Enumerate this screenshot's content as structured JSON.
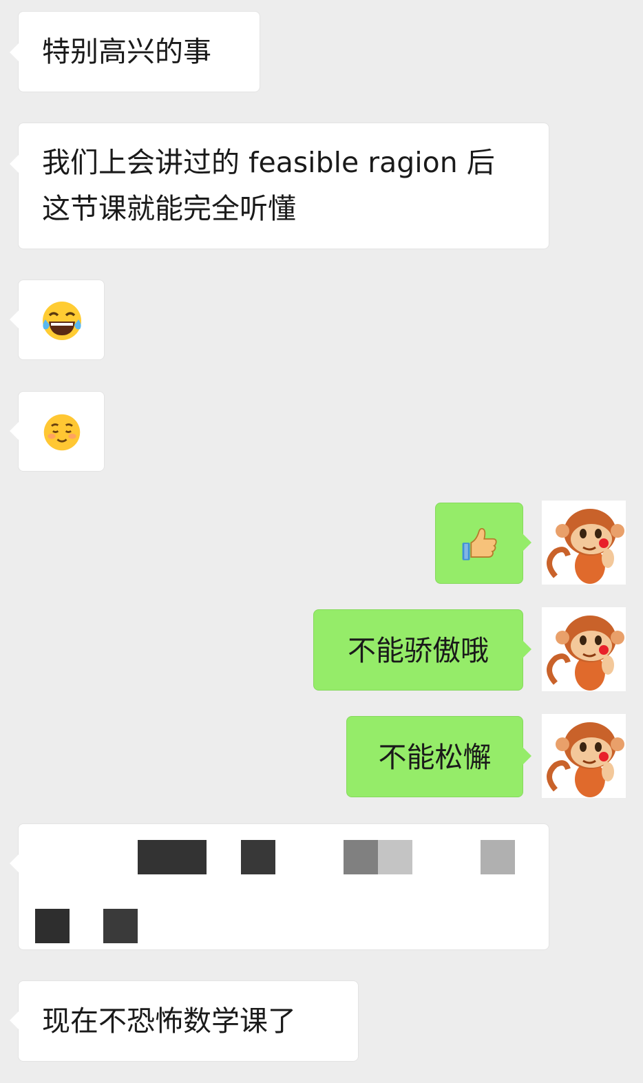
{
  "messages": {
    "m1": "特别高兴的事",
    "m2": "我们上会讲过的 feasible ragion 后\n这节课就能完全听懂",
    "m3_emoji": "laughing-tears-emoji",
    "m4_emoji": "smiling-blush-emoji",
    "m5_emoji": "thumbs-up-emoji",
    "m6": "不能骄傲哦",
    "m7": "不能松懈",
    "m8_redacted": "redacted-message",
    "m9": "现在不恐怖数学课了"
  },
  "avatar_icon": "monkey-avatar-icon",
  "colors": {
    "background": "#ededed",
    "incoming_bubble": "#ffffff",
    "outgoing_bubble": "#95ec69"
  }
}
